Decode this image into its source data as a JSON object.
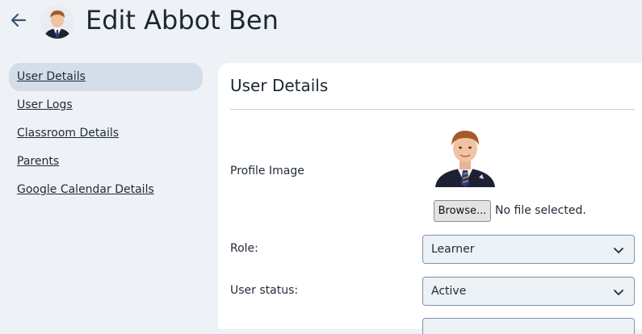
{
  "header": {
    "title": "Edit Abbot Ben",
    "back_icon": "arrow-left-icon",
    "avatar_icon": "user-avatar-photo"
  },
  "sidebar": {
    "items": [
      {
        "label": "User Details",
        "active": true
      },
      {
        "label": "User Logs",
        "active": false
      },
      {
        "label": "Classroom Details",
        "active": false
      },
      {
        "label": "Parents",
        "active": false
      },
      {
        "label": "Google Calendar Details",
        "active": false
      }
    ]
  },
  "main": {
    "section_title": "User Details",
    "profile_image": {
      "label": "Profile Image",
      "browse_label": "Browse...",
      "file_status": "No file selected."
    },
    "role": {
      "label": "Role:",
      "value": "Learner"
    },
    "user_status": {
      "label": "User status:",
      "value": "Active"
    }
  },
  "colors": {
    "page_background": "#eef2f6",
    "active_nav_background": "#d4dee8",
    "panel_background": "#ffffff",
    "select_background": "#edf2f7",
    "select_border": "#7e93a8"
  }
}
